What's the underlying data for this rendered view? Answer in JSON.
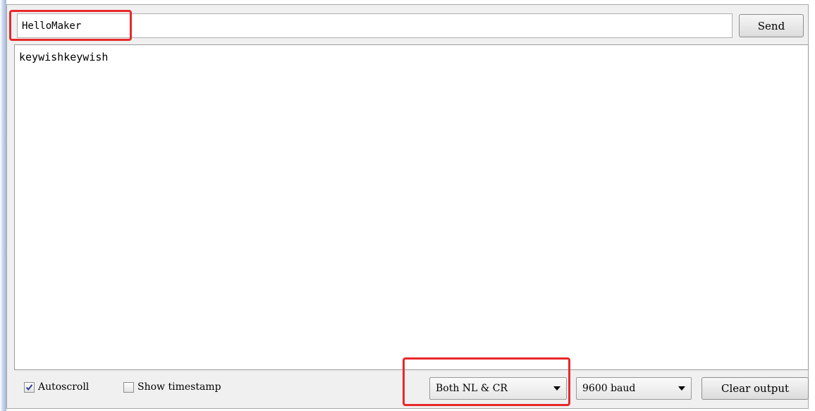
{
  "send_bar": {
    "input_value": "HelloMaker",
    "send_label": "Send"
  },
  "output": {
    "text": "keywishkeywish"
  },
  "bottom_bar": {
    "autoscroll_label": "Autoscroll",
    "autoscroll_checked": true,
    "timestamp_label": "Show timestamp",
    "timestamp_checked": false,
    "line_ending": "Both NL & CR",
    "baud_rate": "9600 baud",
    "clear_label": "Clear output"
  },
  "colors": {
    "highlight": "#e8282b"
  },
  "icons": [
    "checkmark-icon",
    "dropdown-arrow-icon"
  ]
}
